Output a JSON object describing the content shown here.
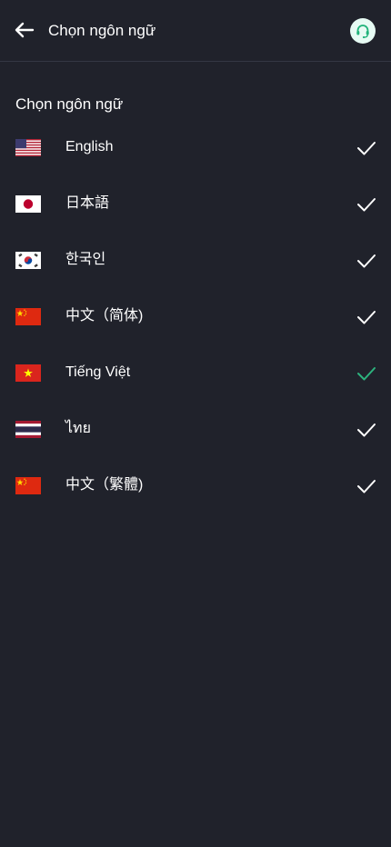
{
  "header": {
    "title": "Chọn ngôn ngữ",
    "back_icon": "arrow-left-icon",
    "support_icon": "headset-icon"
  },
  "section_title": "Chọn ngôn ngữ",
  "languages": [
    {
      "label": "English",
      "flag": "us-flag-icon",
      "selected": false
    },
    {
      "label": "日本語",
      "flag": "japan-flag-icon",
      "selected": false
    },
    {
      "label": "한국인",
      "flag": "korea-flag-icon",
      "selected": false
    },
    {
      "label": "中文（简体)",
      "flag": "china-flag-icon",
      "selected": false
    },
    {
      "label": "Tiếng Việt",
      "flag": "vietnam-flag-icon",
      "selected": true
    },
    {
      "label": "ไทย",
      "flag": "thailand-flag-icon",
      "selected": false
    },
    {
      "label": "中文（繁體)",
      "flag": "china-flag-icon",
      "selected": false
    }
  ],
  "colors": {
    "background": "#20222b",
    "check_default": "#ffffff",
    "check_selected": "#2db37e",
    "support_bg": "#e6faf3",
    "support_fg": "#20b27a"
  }
}
